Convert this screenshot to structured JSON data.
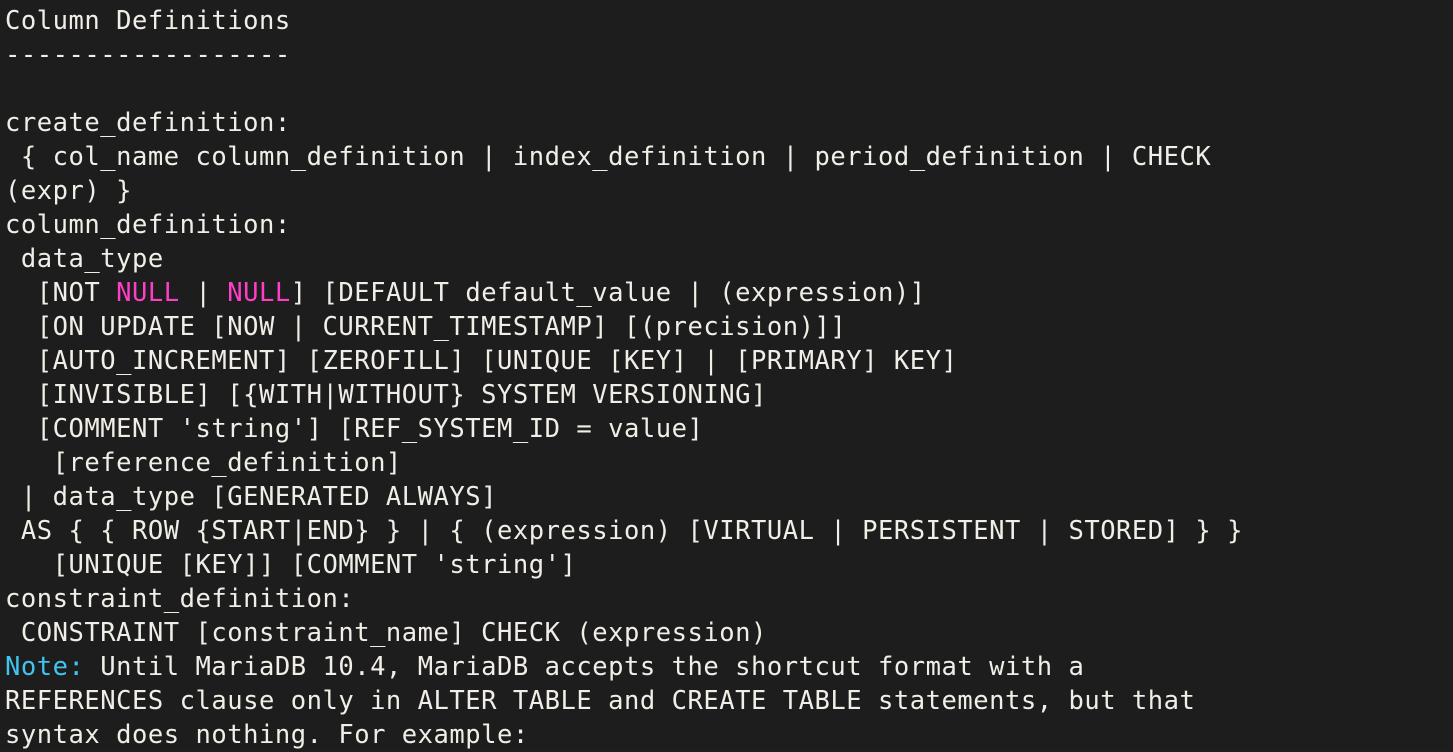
{
  "terminal": {
    "background": "#1d1d1d",
    "foreground": "#f0eee6",
    "accents": {
      "null_keyword": "#ff3ec8",
      "note_keyword": "#3fc4f0"
    },
    "title": "Column Definitions",
    "underline": "------------------",
    "lines": [
      {
        "id": "l01",
        "text": "Column Definitions"
      },
      {
        "id": "l02",
        "text": "------------------"
      },
      {
        "id": "l03",
        "text": ""
      },
      {
        "id": "l04",
        "text": "create_definition:"
      },
      {
        "id": "l05",
        "text": " { col_name column_definition | index_definition | period_definition | CHECK"
      },
      {
        "id": "l06",
        "text": "(expr) }"
      },
      {
        "id": "l07",
        "text": "column_definition:"
      },
      {
        "id": "l08",
        "text": " data_type"
      },
      {
        "id": "l09",
        "pre": "  [NOT ",
        "kw1": "NULL",
        "mid": " | ",
        "kw2": "NULL",
        "post": "] [DEFAULT default_value | (expression)]"
      },
      {
        "id": "l10",
        "text": "  [ON UPDATE [NOW | CURRENT_TIMESTAMP] [(precision)]]"
      },
      {
        "id": "l11",
        "text": "  [AUTO_INCREMENT] [ZEROFILL] [UNIQUE [KEY] | [PRIMARY] KEY]"
      },
      {
        "id": "l12",
        "text": "  [INVISIBLE] [{WITH|WITHOUT} SYSTEM VERSIONING]"
      },
      {
        "id": "l13",
        "text": "  [COMMENT 'string'] [REF_SYSTEM_ID = value]"
      },
      {
        "id": "l14",
        "text": "   [reference_definition]"
      },
      {
        "id": "l15",
        "text": " | data_type [GENERATED ALWAYS]"
      },
      {
        "id": "l16",
        "text": " AS { { ROW {START|END} } | { (expression) [VIRTUAL | PERSISTENT | STORED] } }"
      },
      {
        "id": "l17",
        "text": "   [UNIQUE [KEY]] [COMMENT 'string']"
      },
      {
        "id": "l18",
        "text": "constraint_definition:"
      },
      {
        "id": "l19",
        "text": " CONSTRAINT [constraint_name] CHECK (expression)"
      },
      {
        "id": "l20",
        "note": "Note",
        "colon": ":",
        "rest": " Until MariaDB 10.4, MariaDB accepts the shortcut format with a"
      },
      {
        "id": "l21",
        "text": "REFERENCES clause only in ALTER TABLE and CREATE TABLE statements, but that"
      },
      {
        "id": "l22",
        "text": "syntax does nothing. For example:"
      }
    ]
  }
}
